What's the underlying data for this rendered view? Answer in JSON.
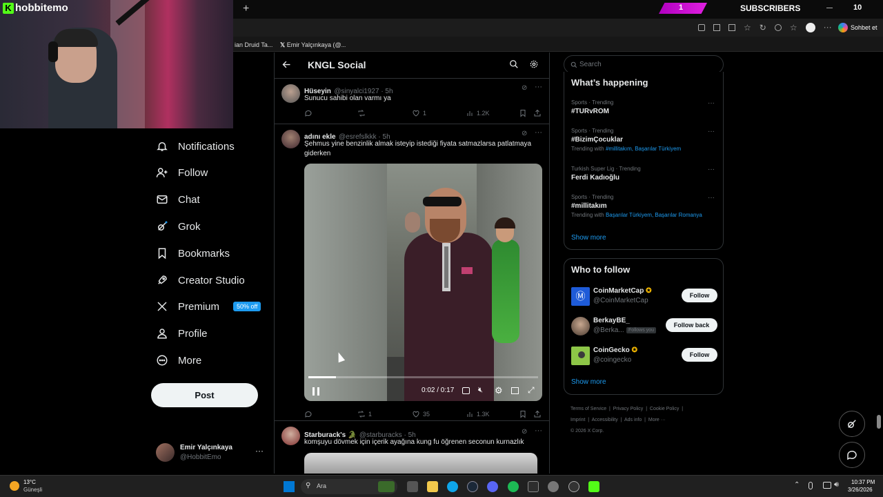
{
  "browser": {
    "tabs": [
      {
        "label": "ian Druid Ta..."
      },
      {
        "label": "Emir Yalçınkaya (@..."
      }
    ],
    "new_tab_label": "+",
    "copilot_label": "Sohbet et",
    "stream_overlay": {
      "sub_count": "1",
      "subscribers_label": "SUBSCRIBERS",
      "counter": "10"
    }
  },
  "stream": {
    "logo_text": "hobbitemo",
    "logo_letter": "K"
  },
  "nav": {
    "items": [
      {
        "label": "Notifications",
        "icon": "bell-icon"
      },
      {
        "label": "Follow",
        "icon": "person-plus-icon"
      },
      {
        "label": "Chat",
        "icon": "mail-icon"
      },
      {
        "label": "Grok",
        "icon": "grok-icon"
      },
      {
        "label": "Bookmarks",
        "icon": "bookmark-icon"
      },
      {
        "label": "Creator Studio",
        "icon": "rocket-icon"
      },
      {
        "label": "Premium",
        "icon": "x-logo-icon"
      },
      {
        "label": "Profile",
        "icon": "profile-icon"
      },
      {
        "label": "More",
        "icon": "more-circle-icon"
      }
    ],
    "premium_badge": "50% off",
    "post_label": "Post",
    "account": {
      "name": "Emir Yalçınkaya",
      "handle": "@HobbitEmo",
      "menu": "···"
    }
  },
  "header": {
    "title": "KNGL Social"
  },
  "tweets": [
    {
      "name": "Hüseyin",
      "handle": "@sinyalci1927 · 5h",
      "text": "Sunucu sahibi olan varmı ya",
      "replies": "",
      "retweets": "",
      "likes": "1",
      "views": "1.2K"
    },
    {
      "name": "adını ekle",
      "handle": "@esrefslkkk · 5h",
      "text": "Şehmus yine benzinlik almak isteyip istediği fiyata satmazlarsa patlatmaya giderken",
      "replies": "",
      "retweets": "1",
      "likes": "35",
      "views": "1.3K",
      "video": {
        "time": "0:02 / 0:17",
        "progress": 0.12
      }
    },
    {
      "name": "Starburack's 🐊",
      "handle": "@starburacks · 5h",
      "text": "komşuyu dövmek için içerik ayağına kung fu öğrenen seconun kurnazlık"
    }
  ],
  "search": {
    "placeholder": "Search"
  },
  "whats_happening": {
    "title": "What’s happening",
    "trends": [
      {
        "category": "Sports · Trending",
        "name": "#TURvROM",
        "with_label": "",
        "with": ""
      },
      {
        "category": "Sports · Trending",
        "name": "#BizimÇocuklar",
        "with_label": "Trending with",
        "with": "#millitakım, Başarılar Türkiyem"
      },
      {
        "category": "Turkish Super Lig · Trending",
        "name": "Ferdi Kadıoğlu",
        "with_label": "",
        "with": ""
      },
      {
        "category": "Sports · Trending",
        "name": "#millitakım",
        "with_label": "Trending with",
        "with": "Başarılar Türkiyem, Başarılar Romanya"
      }
    ],
    "show_more": "Show more"
  },
  "who_to_follow": {
    "title": "Who to follow",
    "accounts": [
      {
        "name": "CoinMarketCap",
        "handle": "@CoinMarketCap",
        "button": "Follow",
        "follows_you": ""
      },
      {
        "name": "BerkayBE_",
        "handle": "@Berka...",
        "button": "Follow back",
        "follows_you": "Follows you"
      },
      {
        "name": "CoinGecko",
        "handle": "@coingecko",
        "button": "Follow",
        "follows_you": ""
      }
    ],
    "show_more": "Show more"
  },
  "footer": {
    "links_row1": [
      "Terms of Service",
      "Privacy Policy",
      "Cookie Policy"
    ],
    "links_row2": [
      "Imprint",
      "Accessibility",
      "Ads info",
      "More ···"
    ],
    "copyright": "© 2026 X Corp."
  },
  "taskbar": {
    "weather_temp": "13°C",
    "weather_desc": "Güneşli",
    "search_label": "Ara",
    "time": "10:37 PM",
    "date": "3/26/2026"
  }
}
